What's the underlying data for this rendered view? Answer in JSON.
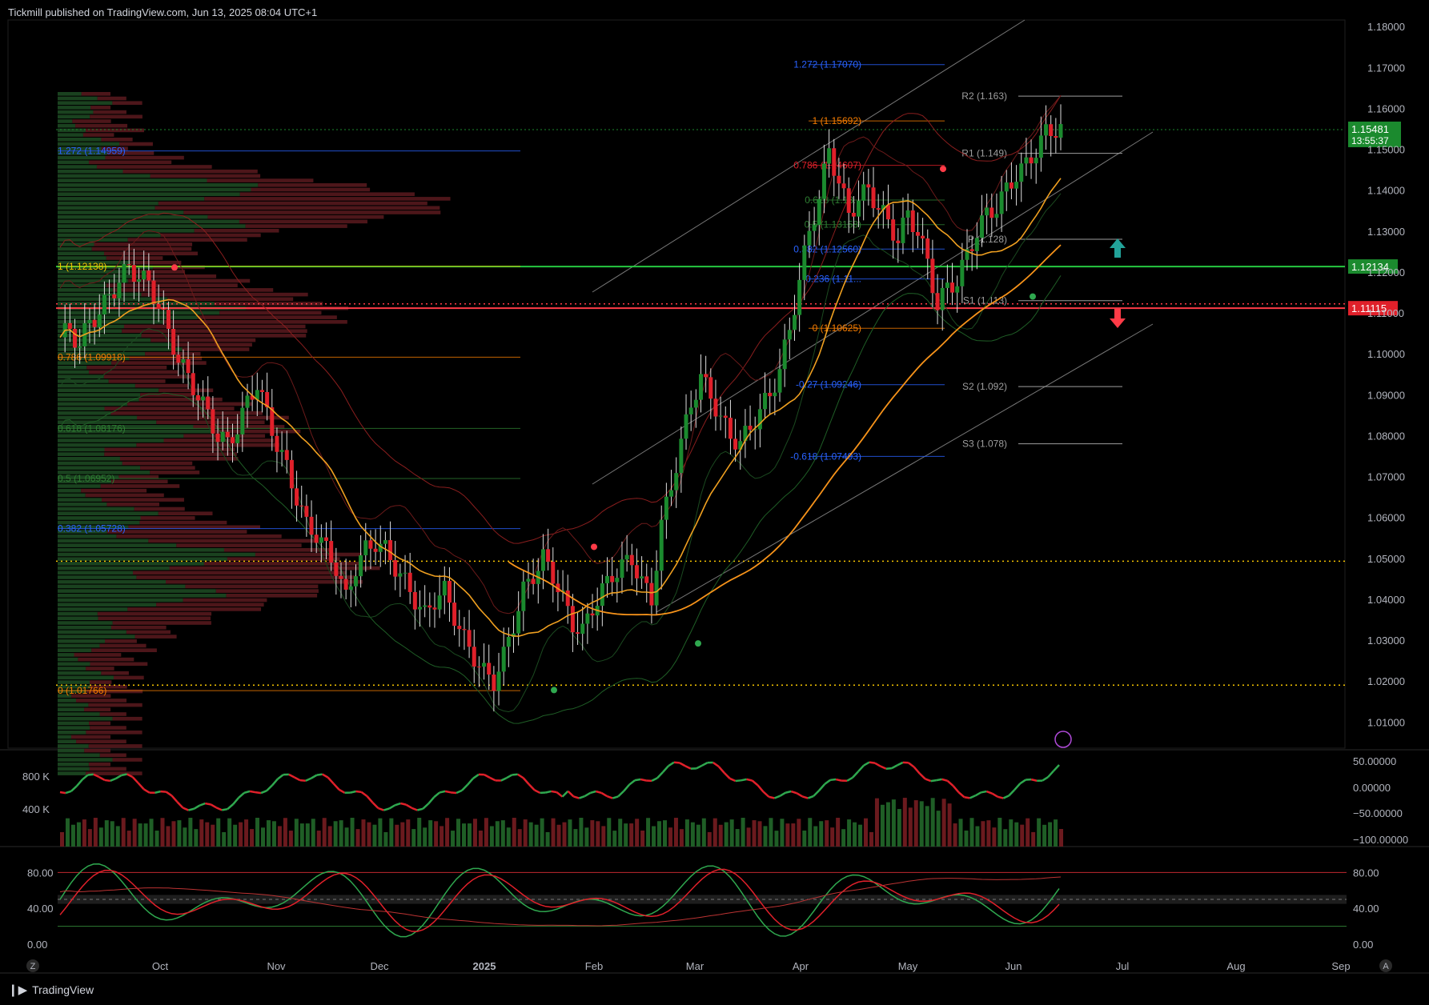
{
  "header": {
    "publisher_line": "Tickmill published on TradingView.com, Jun 13, 2025 08:04 UTC+1"
  },
  "footer": {
    "brand": "TradingView"
  },
  "ui": {
    "z_button": "Z",
    "a_button": "A"
  },
  "colors": {
    "bg": "#000000",
    "bull": "#1b8a2e",
    "bear": "#e0202a",
    "grid": "#151515",
    "ema_fast": "#f0a020",
    "ema_slow": "#f7931a",
    "green_line": "#26c840",
    "red_line": "#ff3b47",
    "yellow_dotted": "#f5c400",
    "fib_blue": "#2962ff",
    "fib_orange": "#f57c00",
    "fib_green": "#2e7d32",
    "pivot": "#9e9e9e"
  },
  "chart_data": [
    {
      "type": "candlestick",
      "title": "",
      "price_axis": {
        "ticks": [
          "1.18000",
          "1.17000",
          "1.16000",
          "1.15000",
          "1.14000",
          "1.13000",
          "1.12000",
          "1.11000",
          "1.10000",
          "1.09000",
          "1.08000",
          "1.07000",
          "1.06000",
          "1.05000",
          "1.04000",
          "1.03000",
          "1.02000",
          "1.01000"
        ],
        "ylim": [
          1.0036,
          1.1816
        ]
      },
      "time_axis": {
        "labels": [
          "Oct",
          "Nov",
          "Dec",
          "2025",
          "Feb",
          "Mar",
          "Apr",
          "May",
          "Jun",
          "Jul",
          "Aug",
          "Sep"
        ]
      },
      "last_price": {
        "value": "1.15481",
        "countdown": "13:55:37"
      },
      "level_badges": [
        {
          "label": "1.12134",
          "color": "#1b8a2e"
        },
        {
          "label": "1.11115",
          "color": "#e0202a"
        }
      ],
      "horizontal_levels": [
        {
          "name": "green-level",
          "value": 1.12134,
          "style": "solid",
          "color": "#26c840"
        },
        {
          "name": "red-level",
          "value": 1.11115,
          "style": "solid",
          "color": "#ff3b47"
        },
        {
          "name": "red-dotted",
          "value": 1.1122,
          "style": "dotted",
          "color": "#ff3b47"
        },
        {
          "name": "yellow-dotted-upper",
          "value": 1.0493,
          "style": "dotted",
          "color": "#f5c400"
        },
        {
          "name": "yellow-dotted-lower",
          "value": 1.019,
          "style": "dotted",
          "color": "#f5c400"
        }
      ],
      "fib_left": [
        {
          "label": "1.272 (1.14959)",
          "value": 1.14959,
          "color": "#2962ff"
        },
        {
          "label": "1 (1.12138)",
          "value": 1.12138,
          "color": "#f5c400"
        },
        {
          "label": "0.786 (1.09918)",
          "value": 1.09918,
          "color": "#f57c00"
        },
        {
          "label": "0.618 (1.08176)",
          "value": 1.08176,
          "color": "#2e7d32"
        },
        {
          "label": "0.5 (1.06952)",
          "value": 1.06952,
          "color": "#2e7d32"
        },
        {
          "label": "0.382 (1.05728)",
          "value": 1.05728,
          "color": "#2962ff"
        },
        {
          "label": "0 (1.01766)",
          "value": 1.01766,
          "color": "#f57c00"
        }
      ],
      "fib_right": [
        {
          "label": "1.272 (1.17070)",
          "value": 1.1707,
          "color": "#2962ff"
        },
        {
          "label": "1 (1.15692)",
          "value": 1.15692,
          "color": "#f57c00"
        },
        {
          "label": "0.786 (1.14607)",
          "value": 1.14607,
          "color": "#e0202a"
        },
        {
          "label": "0.618 (1.13...",
          "value": 1.1376,
          "color": "#2e7d32"
        },
        {
          "label": "0.5 (1.13158)",
          "value": 1.13158,
          "color": "#2e7d32"
        },
        {
          "label": "0.382 (1.12560)",
          "value": 1.1256,
          "color": "#2962ff"
        },
        {
          "label": "0.236 (1.11...",
          "value": 1.1183,
          "color": "#2962ff"
        },
        {
          "label": "0 (1.10625)",
          "value": 1.10625,
          "color": "#f57c00"
        },
        {
          "label": "-0.27 (1.09246)",
          "value": 1.09246,
          "color": "#2962ff"
        },
        {
          "label": "-0.618 (1.07493)",
          "value": 1.07493,
          "color": "#2962ff"
        }
      ],
      "pivots": [
        {
          "label": "R2 (1.163)",
          "value": 1.163
        },
        {
          "label": "R1 (1.149)",
          "value": 1.149
        },
        {
          "label": "P (1.128)",
          "value": 1.128
        },
        {
          "label": "S1 (1.113)",
          "value": 1.113
        },
        {
          "label": "S2 (1.092)",
          "value": 1.092
        },
        {
          "label": "S3 (1.078)",
          "value": 1.078
        }
      ],
      "close_path": [
        1.104,
        1.106,
        1.102,
        1.108,
        1.11,
        1.114,
        1.118,
        1.121,
        1.119,
        1.117,
        1.112,
        1.105,
        1.099,
        1.094,
        1.09,
        1.085,
        1.08,
        1.078,
        1.082,
        1.088,
        1.093,
        1.085,
        1.078,
        1.072,
        1.065,
        1.058,
        1.056,
        1.052,
        1.048,
        1.04,
        1.048,
        1.052,
        1.054,
        1.052,
        1.048,
        1.044,
        1.04,
        1.036,
        1.04,
        1.042,
        1.036,
        1.03,
        1.026,
        1.022,
        1.02,
        1.026,
        1.034,
        1.042,
        1.046,
        1.05,
        1.046,
        1.04,
        1.034,
        1.032,
        1.038,
        1.042,
        1.046,
        1.048,
        1.05,
        1.044,
        1.04,
        1.058,
        1.068,
        1.078,
        1.088,
        1.094,
        1.09,
        1.084,
        1.08,
        1.078,
        1.082,
        1.086,
        1.09,
        1.096,
        1.106,
        1.118,
        1.13,
        1.138,
        1.15,
        1.142,
        1.134,
        1.138,
        1.14,
        1.136,
        1.132,
        1.128,
        1.134,
        1.13,
        1.122,
        1.112,
        1.116,
        1.118,
        1.124,
        1.13,
        1.134,
        1.136,
        1.14,
        1.144,
        1.146,
        1.15,
        1.154,
        1.155
      ],
      "lower_panel": {
        "volume_axis_labels": [
          "800 K",
          "400 K"
        ],
        "oscillator_axis": [
          "50.00000",
          "0.00000",
          "−50.00000",
          "−100.00000"
        ]
      },
      "stochastic_panel": {
        "axis": [
          "80.00",
          "40.00",
          "0.00"
        ],
        "right_axis": [
          "80.00",
          "40.00",
          "0.00"
        ]
      }
    }
  ]
}
